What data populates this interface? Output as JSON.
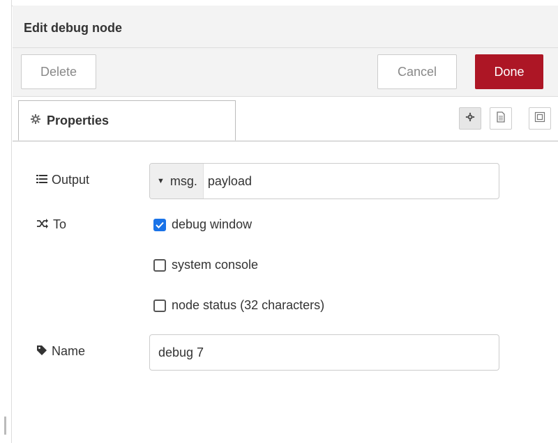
{
  "tray": {
    "title": "Edit debug node",
    "delete_label": "Delete",
    "cancel_label": "Cancel",
    "done_label": "Done",
    "done_color": "#ad1625"
  },
  "tabs": {
    "properties_label": "Properties",
    "icons": [
      "gear-icon",
      "document-icon",
      "expand-icon"
    ]
  },
  "form": {
    "output": {
      "label": "Output",
      "type_prefix": "msg.",
      "value": "payload"
    },
    "to": {
      "label": "To",
      "options": [
        {
          "label": "debug window",
          "checked": true
        },
        {
          "label": "system console",
          "checked": false
        },
        {
          "label": "node status (32 characters)",
          "checked": false
        }
      ]
    },
    "name": {
      "label": "Name",
      "value": "debug 7"
    }
  },
  "colors": {
    "accent": "#1a73e8"
  }
}
